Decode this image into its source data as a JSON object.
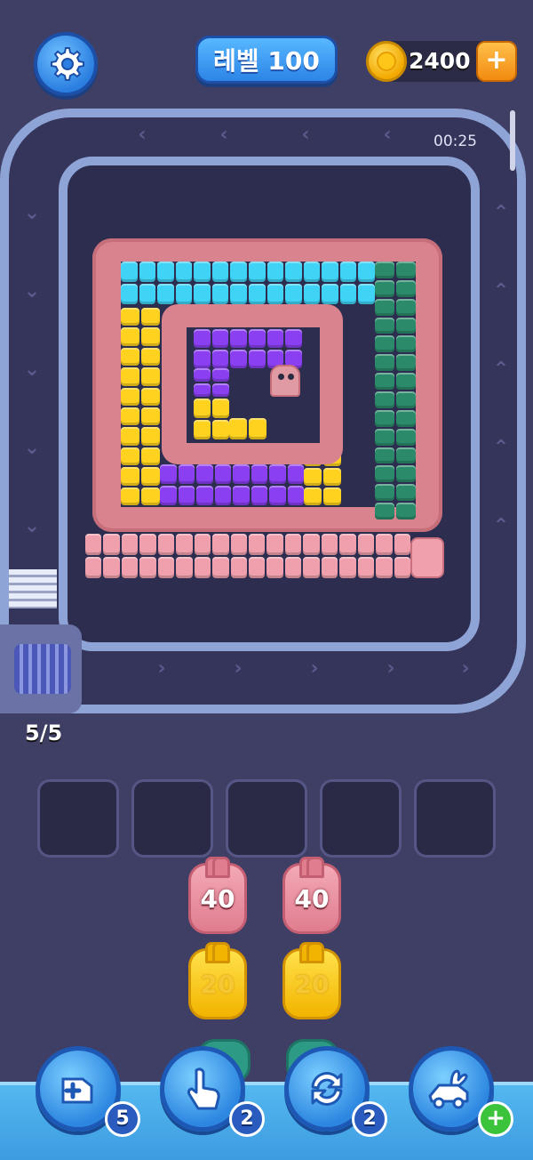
{
  "header": {
    "level_label": "레벨 100",
    "coins": "2400",
    "plus_symbol": "+"
  },
  "board": {
    "timer": "00:25",
    "queue_counter": "5/5"
  },
  "colors": {
    "cyan": "#3fd3f5",
    "green": "#2b8a6a",
    "yellow": "#ffd21f",
    "purple": "#8a3ff0",
    "pink": "#f0a0ac",
    "worm": "#d9838e",
    "track": "#8fa4d6"
  },
  "slots": [
    "",
    "",
    "",
    "",
    ""
  ],
  "pigs": [
    {
      "value": "40",
      "color": "pink"
    },
    {
      "value": "40",
      "color": "pink"
    },
    {
      "value": "20",
      "color": "yellow"
    },
    {
      "value": "20",
      "color": "yellow"
    }
  ],
  "boosters": [
    {
      "icon": "add-block-icon",
      "count": "5"
    },
    {
      "icon": "pointer-hand-icon",
      "count": "2"
    },
    {
      "icon": "shuffle-icon",
      "count": "2"
    },
    {
      "icon": "rabbit-vehicle-icon",
      "count": "+"
    }
  ]
}
